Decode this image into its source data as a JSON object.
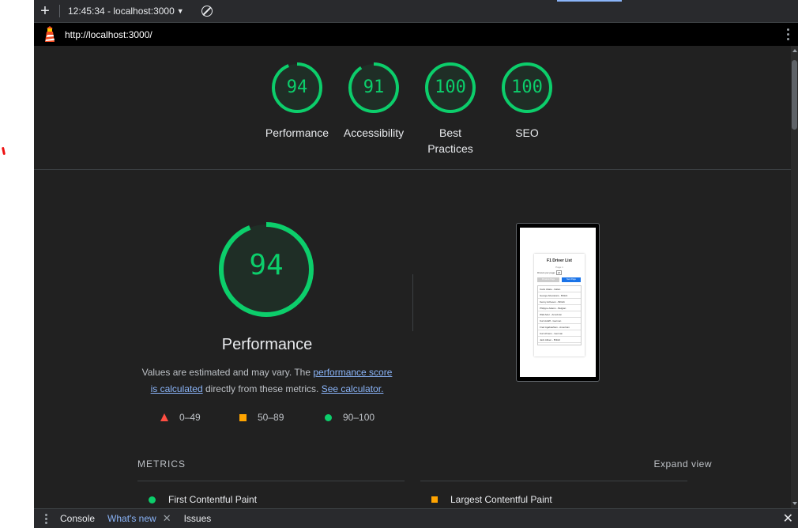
{
  "toolbar": {
    "new_report_icon": "plus-icon",
    "report_label": "12:45:34 - localhost:3000",
    "dropdown_icon": "caret-down-icon",
    "clear_icon": "clear-icon"
  },
  "urlbar": {
    "url": "http://localhost:3000/",
    "logo_icon": "lighthouse-icon",
    "menu_icon": "kebab-menu-icon"
  },
  "gauges": [
    {
      "score": "94",
      "label": "Performance"
    },
    {
      "score": "91",
      "label": "Accessibility"
    },
    {
      "score": "100",
      "label": "Best Practices",
      "label_line1": "Best",
      "label_line2": "Practices"
    },
    {
      "score": "100",
      "label": "SEO"
    }
  ],
  "performance": {
    "score": "94",
    "title": "Performance",
    "desc_part1": "Values are estimated and may vary. The ",
    "link1": "performance score is calculated",
    "link1_a": "performance score",
    "link1_b": "is calculated",
    "desc_part2": " directly from these metrics. ",
    "link2": "See calculator."
  },
  "legend": [
    {
      "range": "0–49",
      "icon": "fail-triangle-icon"
    },
    {
      "range": "50–89",
      "icon": "average-square-icon"
    },
    {
      "range": "90–100",
      "icon": "pass-circle-icon"
    }
  ],
  "screenshot": {
    "title": "F1 Driver List",
    "page": "Page 1",
    "drivers_per_page": "Drivers per page:",
    "per_page_value": "20",
    "prev_button": "Previous Page",
    "next_button": "Next Page",
    "rows": [
      "Carlo Abate - Italian",
      "George Abecassis - British",
      "Kenny Acheson - British",
      "Philippe Adams - Belgian",
      "Walt Ader - American",
      "Kurt Adolff - German",
      "Fred Agabashian - American",
      "Kurt Ahrens - German",
      "Jack Aitken - British"
    ]
  },
  "metrics": {
    "heading": "METRICS",
    "expand": "Expand view",
    "items": [
      {
        "label": "First Contentful Paint",
        "status": "pass"
      },
      {
        "label": "Largest Contentful Paint",
        "status": "average"
      }
    ]
  },
  "drawer": {
    "tabs": [
      "Console",
      "What's new",
      "Issues"
    ],
    "active_tab": "What's new"
  },
  "colors": {
    "pass": "#0cce6b",
    "average": "#ffa400",
    "fail": "#ff4e42",
    "link": "#8ab4f8",
    "background": "#212121"
  }
}
